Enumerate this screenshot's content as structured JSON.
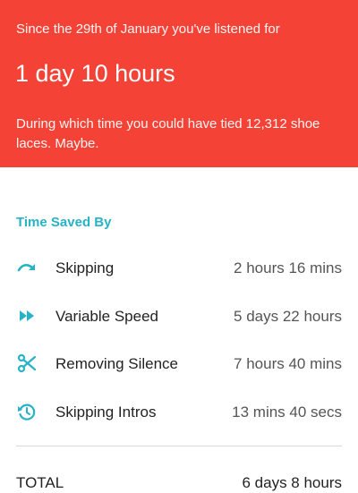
{
  "summary": {
    "since_text": "Since the 29th of January you've listened for",
    "listened_duration": "1 day 10 hours",
    "blurb": "During which time you could have tied 12,312 shoe laces. Maybe."
  },
  "time_saved": {
    "title": "Time Saved By",
    "items": [
      {
        "icon": "skip-arrow-icon",
        "label": "Skipping",
        "value": "2 hours 16 mins"
      },
      {
        "icon": "fast-forward-icon",
        "label": "Variable Speed",
        "value": "5 days 22 hours"
      },
      {
        "icon": "scissors-icon",
        "label": "Removing Silence",
        "value": "7 hours 40 mins"
      },
      {
        "icon": "skip-intro-clock-icon",
        "label": "Skipping Intros",
        "value": "13 mins 40 secs"
      }
    ]
  },
  "total": {
    "label": "TOTAL",
    "value": "6 days 8 hours"
  },
  "colors": {
    "header_background": "#f44336",
    "accent": "#26b3c6"
  }
}
